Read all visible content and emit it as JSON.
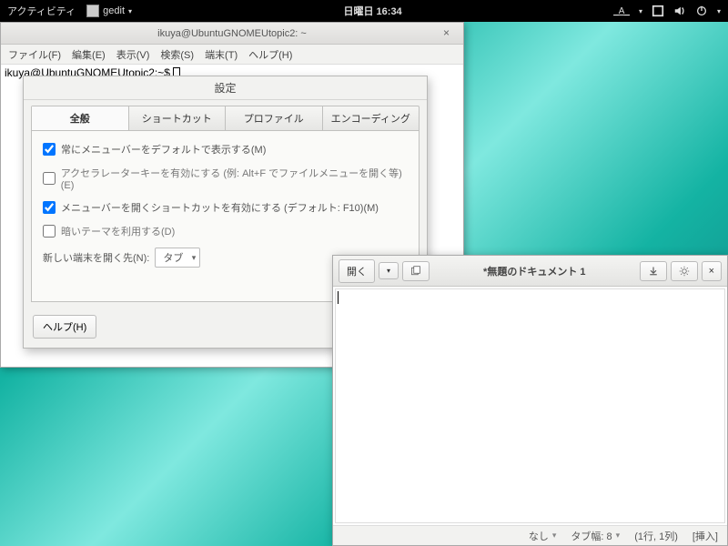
{
  "topbar": {
    "activities": "アクティビティ",
    "appmenu": "gedit",
    "clock": "日曜日 16:34",
    "a11y": "_A_"
  },
  "terminal": {
    "title": "ikuya@UbuntuGNOMEUtopic2: ~",
    "menus": {
      "file": "ファイル(F)",
      "edit": "編集(E)",
      "view": "表示(V)",
      "search": "検索(S)",
      "terminal": "端末(T)",
      "help": "ヘルプ(H)"
    },
    "prompt": "ikuya@UbuntuGNOMEUtopic2:~$ "
  },
  "prefs": {
    "title": "設定",
    "tabs": {
      "general": "全般",
      "shortcuts": "ショートカット",
      "profiles": "プロファイル",
      "encodings": "エンコーディング"
    },
    "opts": {
      "menubar": "常にメニューバーをデフォルトで表示する(M)",
      "accel": "アクセラレーターキーを有効にする (例: Alt+F でファイルメニューを開く等)(E)",
      "shortcut": "メニューバーを開くショートカットを有効にする (デフォルト: F10)(M)",
      "dark": "暗いテーマを利用する(D)",
      "newterm_label": "新しい端末を開く先(N):",
      "newterm_value": "タブ"
    },
    "help": "ヘルプ(H)"
  },
  "gedit": {
    "open": "開く",
    "title": "*無題のドキュメント 1",
    "status": {
      "hl": "なし",
      "tabw": "タブ幅: 8",
      "pos": "(1行, 1列)",
      "ins": "[挿入]"
    }
  }
}
